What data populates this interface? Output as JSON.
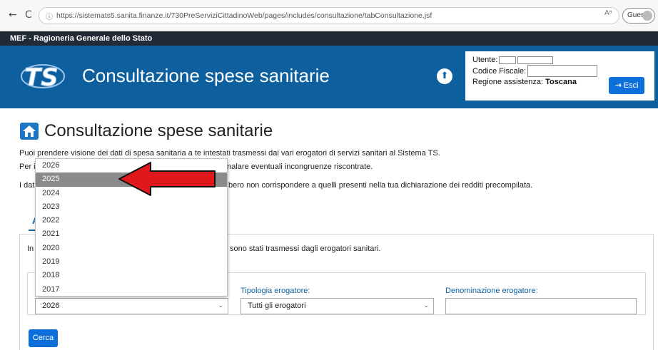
{
  "browser": {
    "back_icon": "←",
    "reload_icon": "C",
    "url": "https://sistemats5.sanita.finanze.it/730PreServiziCittadinoWeb/pages/includes/consultazione/tabConsultazione.jsf",
    "read_aloud": "Aᵃ",
    "profile_label": "Guest"
  },
  "topbar": {
    "label": "MEF - Ragioneria Generale dello Stato"
  },
  "header": {
    "title": "Consultazione spese sanitarie",
    "upload_icon": "⬆",
    "user": {
      "utente_label": "Utente:",
      "cf_label": "Codice Fiscale:",
      "regione_label": "Regione assistenza:",
      "regione_value": "Toscana",
      "esci_label": "Esci",
      "esci_icon": "⇥"
    }
  },
  "page": {
    "title": "Consultazione spese sanitarie",
    "para1": "Puoi prendere visione dei dati di spesa sanitaria a te intestati trasmessi dai vari erogatori di servizi sanitari al Sistema TS.",
    "para2_start": "Per i",
    "para2_end": "gnalare eventuali incongruenze riscontrate.",
    "para3_start": "I dati",
    "para3_end": "bero non corrispondere a quelli presenti nella tua dichiarazione dei redditi precompilata.",
    "tab_fragment": "A",
    "panel_text_start": "In",
    "panel_text_end": "sono stati trasmessi dagli erogatori sanitari."
  },
  "form": {
    "year_selected": "2026",
    "year_options": [
      "2026",
      "2025",
      "2024",
      "2023",
      "2022",
      "2021",
      "2020",
      "2019",
      "2018",
      "2017"
    ],
    "year_highlighted": "2025",
    "tipologia_label": "Tipologia erogatore:",
    "tipologia_value": "Tutti gli erogatori",
    "denominazione_label": "Denominazione erogatore:",
    "denominazione_value": "",
    "cerca_label": "Cerca",
    "caret_icon": "⌄"
  },
  "colors": {
    "header_blue": "#0d5f9e",
    "button_blue": "#0d6fd9",
    "topbar_dark": "#222a35",
    "arrow_red": "#e0171b"
  }
}
